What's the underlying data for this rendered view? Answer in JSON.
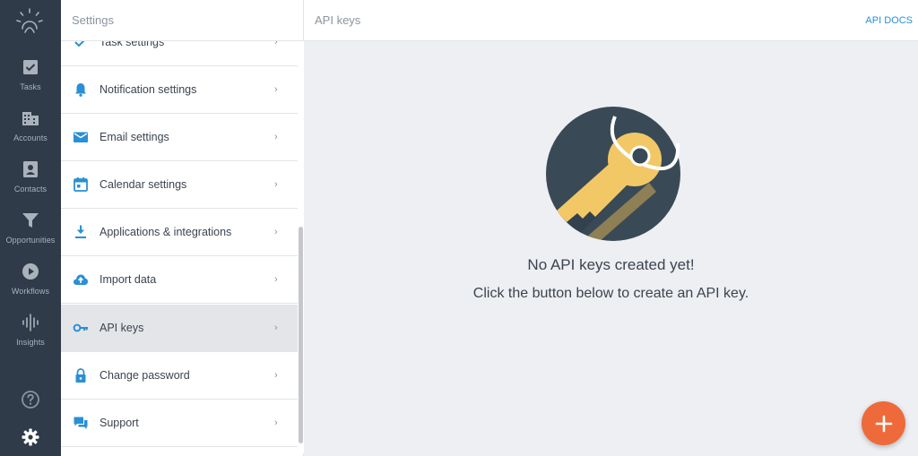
{
  "rail": {
    "items": [
      {
        "label": "Tasks",
        "icon": "tasks-icon"
      },
      {
        "label": "Accounts",
        "icon": "accounts-icon"
      },
      {
        "label": "Contacts",
        "icon": "contacts-icon"
      },
      {
        "label": "Opportunities",
        "icon": "funnel-icon"
      },
      {
        "label": "Workflows",
        "icon": "play-icon"
      },
      {
        "label": "Insights",
        "icon": "insights-icon"
      }
    ]
  },
  "settings": {
    "title": "Settings",
    "items": [
      {
        "label": "Task settings",
        "icon": "check-icon"
      },
      {
        "label": "Notification settings",
        "icon": "bell-icon"
      },
      {
        "label": "Email settings",
        "icon": "envelope-icon"
      },
      {
        "label": "Calendar settings",
        "icon": "calendar-icon"
      },
      {
        "label": "Applications & integrations",
        "icon": "download-icon"
      },
      {
        "label": "Import data",
        "icon": "cloud-upload-icon"
      },
      {
        "label": "API keys",
        "icon": "key-icon"
      },
      {
        "label": "Change password",
        "icon": "lock-icon"
      },
      {
        "label": "Support",
        "icon": "chat-icon"
      }
    ],
    "chevron": "›"
  },
  "main": {
    "title": "API keys",
    "docs_link": "API DOCS",
    "empty_title": "No API keys created yet!",
    "empty_subtitle": "Click the button below to create an API key."
  },
  "colors": {
    "accent": "#2a8fd6",
    "fab": "#ee6a3a",
    "rail": "#2f3b48",
    "key": "#f2c866"
  }
}
